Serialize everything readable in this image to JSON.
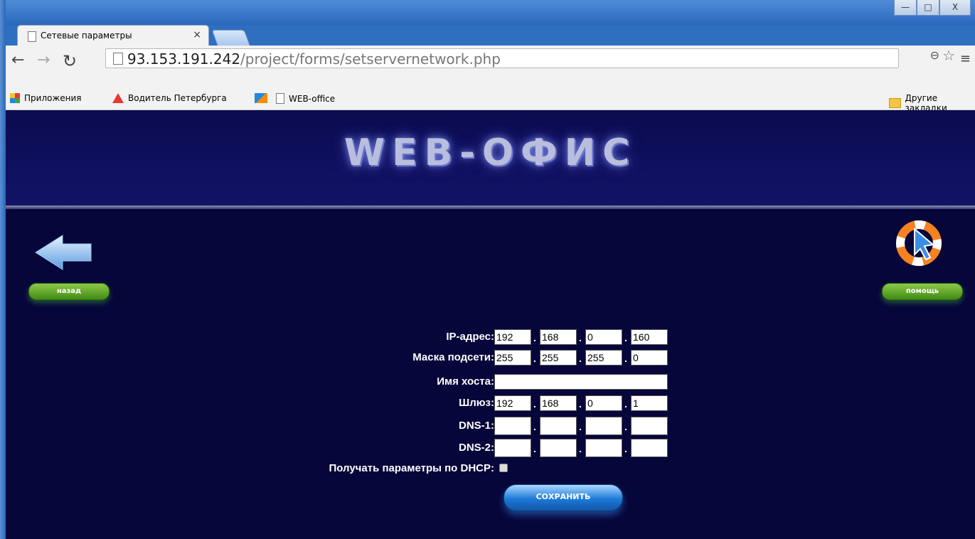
{
  "browser": {
    "tab_title": "Сетевые параметры",
    "tab_close": "×",
    "url_host": "93.153.191.242",
    "url_path": "/project/forms/setservernetwork.php",
    "window_buttons": {
      "minimize": "—",
      "maximize": "□",
      "close": "X"
    }
  },
  "bookmarks": {
    "apps": "Приложения",
    "item1": "Водитель Петербурга",
    "item2": "WEB-office",
    "other": "Другие закладки"
  },
  "page": {
    "logo": "WEB-ОФИС",
    "back_label": "назад",
    "help_label": "помощь",
    "save_label": "СОХРАНИТЬ"
  },
  "form": {
    "ip_label": "IP-адрес:",
    "ip": [
      "192",
      "168",
      "0",
      "160"
    ],
    "mask_label": "Маска подсети:",
    "mask": [
      "255",
      "255",
      "255",
      "0"
    ],
    "host_label": "Имя хоста:",
    "host": "",
    "gateway_label": "Шлюз:",
    "gateway": [
      "192",
      "168",
      "0",
      "1"
    ],
    "dns1_label": "DNS-1:",
    "dns1": [
      "",
      "",
      "",
      ""
    ],
    "dns2_label": "DNS-2:",
    "dns2": [
      "",
      "",
      "",
      ""
    ],
    "dhcp_label": "Получать параметры по DHCP:",
    "dhcp": false,
    "separator": "."
  },
  "colors": {
    "page_bg": "#06063a",
    "header_bg": "#0f105e",
    "pill_green": "#3f8b12",
    "save_blue": "#1d79d8"
  }
}
